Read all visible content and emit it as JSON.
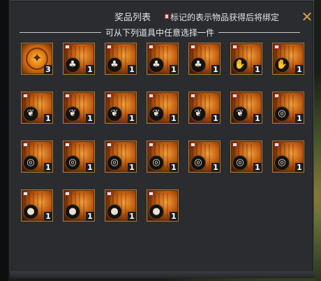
{
  "header": {
    "title": "奖品列表",
    "bind_note": "标记的表示物品获得后将绑定"
  },
  "subheader": "可从下列道具中任意选择一件",
  "items": [
    {
      "kind": "coin",
      "emblem": "✦",
      "qty": "3"
    },
    {
      "kind": "armor",
      "emblem": "♣",
      "qty": "1"
    },
    {
      "kind": "armor",
      "emblem": "♣",
      "qty": "1"
    },
    {
      "kind": "armor",
      "emblem": "♣",
      "qty": "1"
    },
    {
      "kind": "armor",
      "emblem": "♣",
      "qty": "1"
    },
    {
      "kind": "glove",
      "emblem": "✋",
      "qty": "1"
    },
    {
      "kind": "glove",
      "emblem": "✋",
      "qty": "1"
    },
    {
      "kind": "boots",
      "emblem": "❦",
      "qty": "1"
    },
    {
      "kind": "boots",
      "emblem": "❦",
      "qty": "1"
    },
    {
      "kind": "boots",
      "emblem": "❦",
      "qty": "1"
    },
    {
      "kind": "boots",
      "emblem": "❦",
      "qty": "1"
    },
    {
      "kind": "boots",
      "emblem": "❦",
      "qty": "1"
    },
    {
      "kind": "boots",
      "emblem": "❦",
      "qty": "1"
    },
    {
      "kind": "ring",
      "emblem": "◎",
      "qty": "1"
    },
    {
      "kind": "ring",
      "emblem": "◎",
      "qty": "1"
    },
    {
      "kind": "ring",
      "emblem": "◎",
      "qty": "1"
    },
    {
      "kind": "ring",
      "emblem": "◎",
      "qty": "1"
    },
    {
      "kind": "ring",
      "emblem": "◎",
      "qty": "1"
    },
    {
      "kind": "ring",
      "emblem": "◎",
      "qty": "1"
    },
    {
      "kind": "ring",
      "emblem": "◎",
      "qty": "1"
    },
    {
      "kind": "ring",
      "emblem": "◎",
      "qty": "1"
    },
    {
      "kind": "cape",
      "emblem": "●",
      "qty": "1"
    },
    {
      "kind": "cape",
      "emblem": "●",
      "qty": "1"
    },
    {
      "kind": "cape",
      "emblem": "●",
      "qty": "1"
    },
    {
      "kind": "cape",
      "emblem": "●",
      "qty": "1"
    }
  ]
}
